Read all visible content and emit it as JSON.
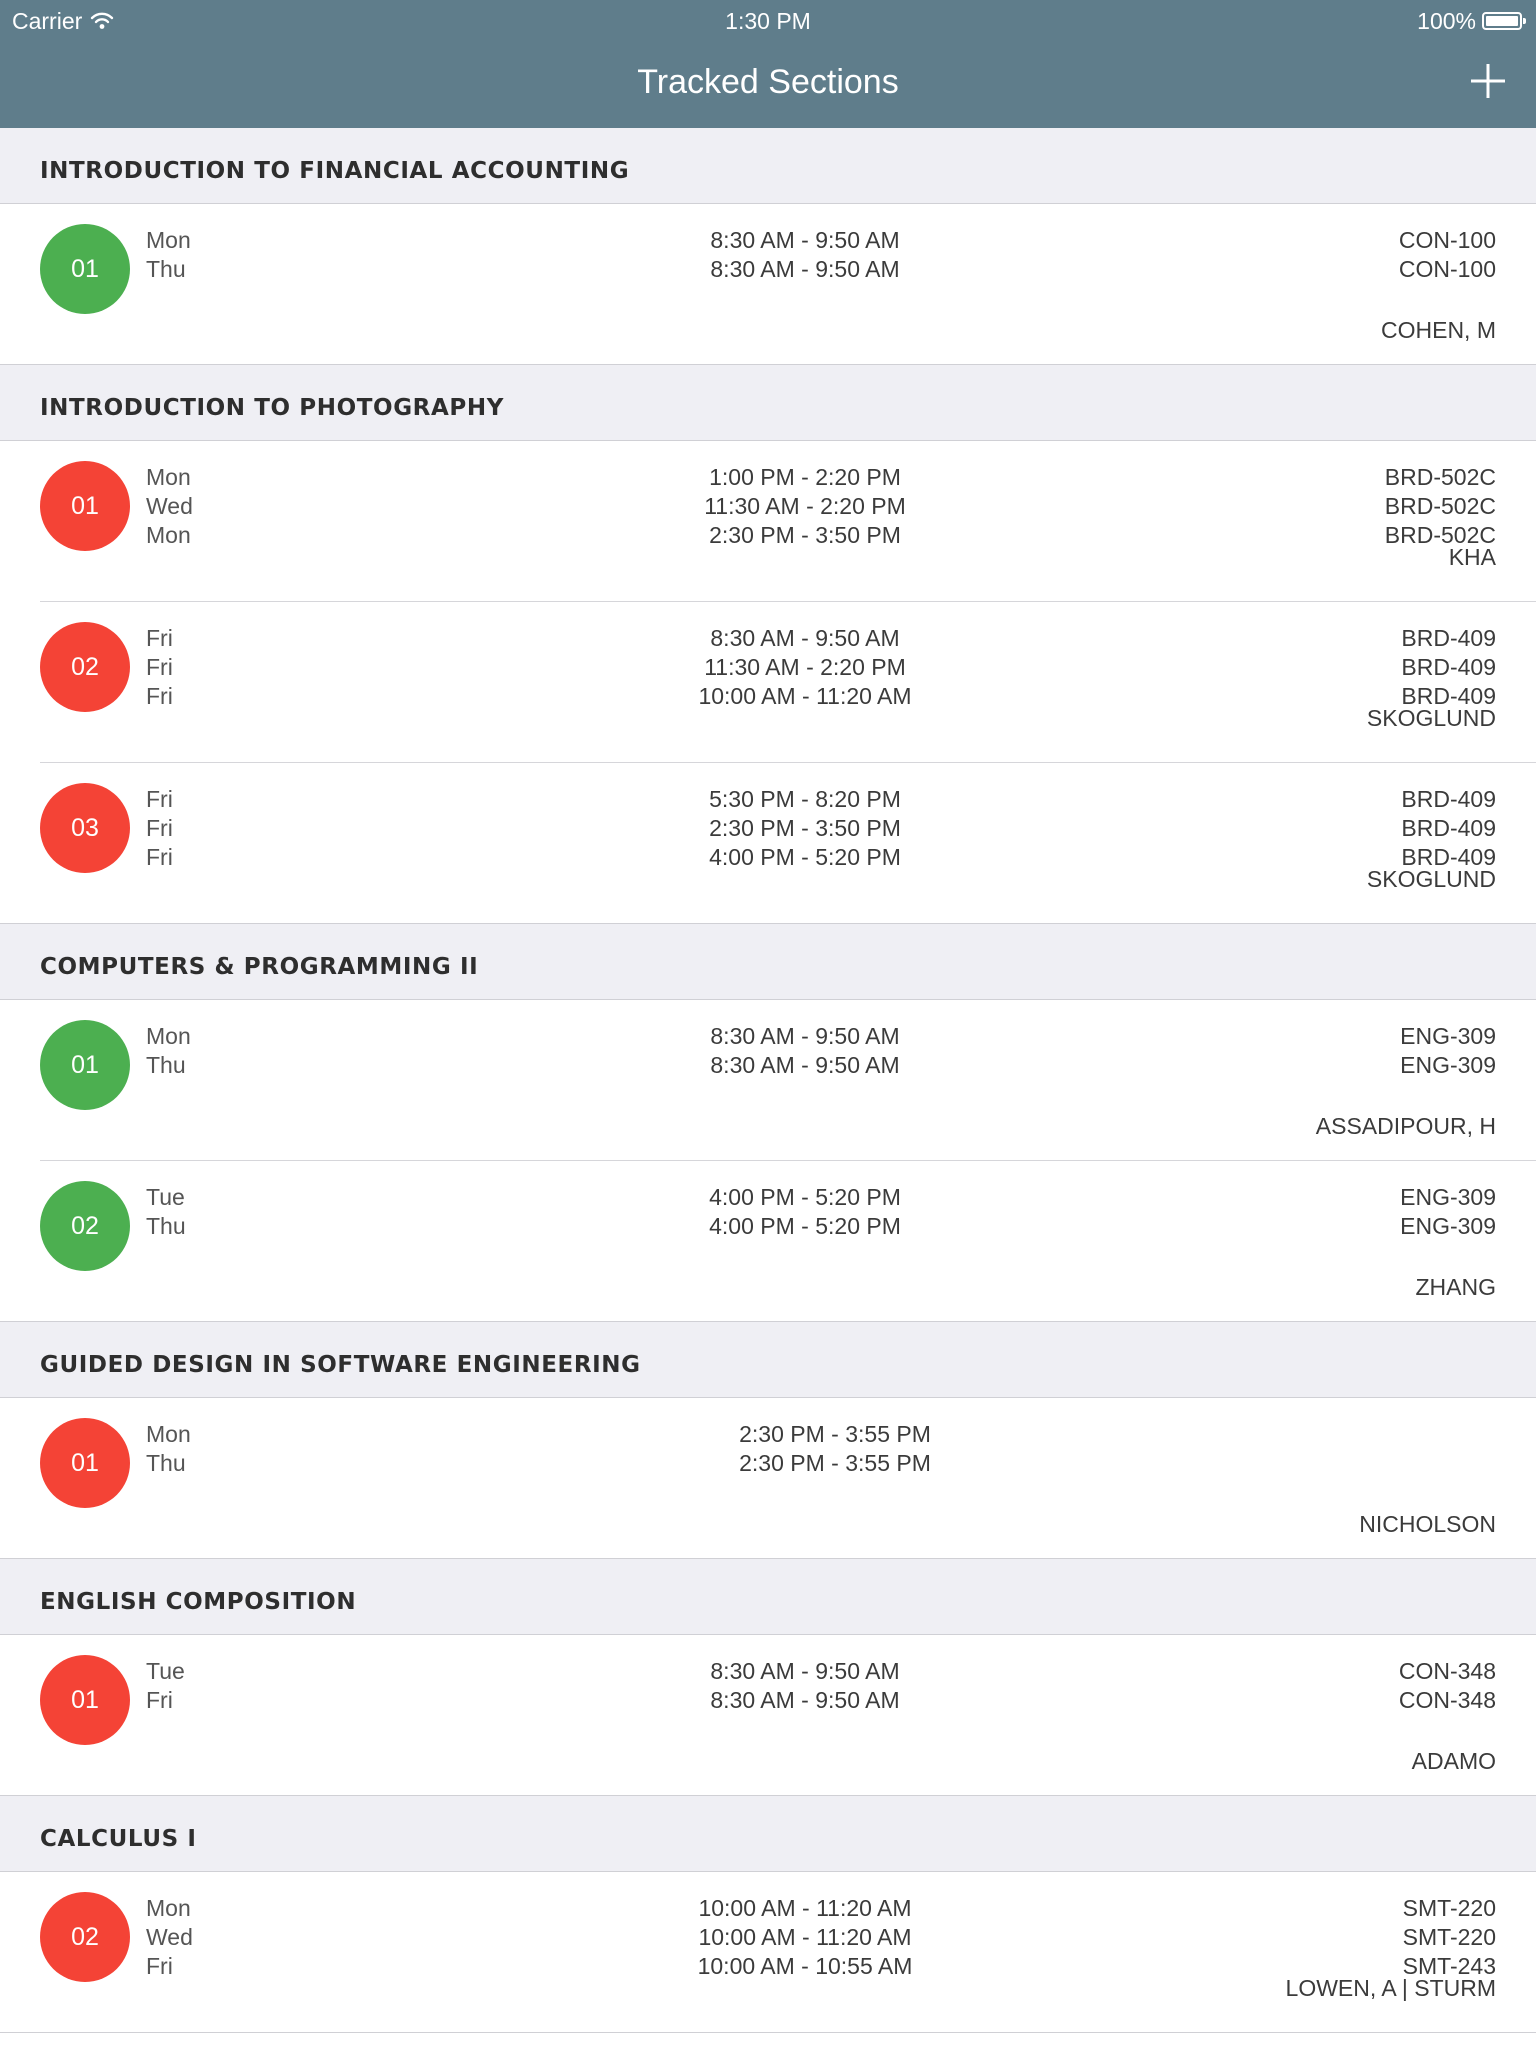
{
  "status_bar": {
    "carrier": "Carrier",
    "time": "1:30 PM",
    "battery": "100%"
  },
  "nav": {
    "title": "Tracked Sections",
    "add_icon": "plus-icon"
  },
  "colors": {
    "open": "#4caf50",
    "closed": "#f44336",
    "nav_bg": "#5f7d8b"
  },
  "courses": [
    {
      "title": "INTRODUCTION TO FINANCIAL ACCOUNTING",
      "sections": [
        {
          "number": "01",
          "status": "open",
          "days": [
            "Mon",
            "Thu"
          ],
          "times": [
            "8:30 AM - 9:50 AM",
            "8:30 AM - 9:50 AM"
          ],
          "rooms": [
            "CON-100",
            "CON-100"
          ],
          "instructor": "COHEN, M"
        }
      ]
    },
    {
      "title": "INTRODUCTION TO PHOTOGRAPHY",
      "sections": [
        {
          "number": "01",
          "status": "closed",
          "days": [
            "Mon",
            "Wed",
            "Mon"
          ],
          "times": [
            "1:00 PM - 2:20 PM",
            "11:30 AM - 2:20 PM",
            "2:30 PM - 3:50 PM"
          ],
          "rooms": [
            "BRD-502C",
            "BRD-502C",
            "BRD-502C"
          ],
          "instructor": "KHA"
        },
        {
          "number": "02",
          "status": "closed",
          "days": [
            "Fri",
            "Fri",
            "Fri"
          ],
          "times": [
            "8:30 AM - 9:50 AM",
            "11:30 AM - 2:20 PM",
            "10:00 AM - 11:20 AM"
          ],
          "rooms": [
            "BRD-409",
            "BRD-409",
            "BRD-409"
          ],
          "instructor": "SKOGLUND"
        },
        {
          "number": "03",
          "status": "closed",
          "days": [
            "Fri",
            "Fri",
            "Fri"
          ],
          "times": [
            "5:30 PM - 8:20 PM",
            "2:30 PM - 3:50 PM",
            "4:00 PM - 5:20 PM"
          ],
          "rooms": [
            "BRD-409",
            "BRD-409",
            "BRD-409"
          ],
          "instructor": "SKOGLUND"
        }
      ]
    },
    {
      "title": "COMPUTERS & PROGRAMMING II",
      "sections": [
        {
          "number": "01",
          "status": "open",
          "days": [
            "Mon",
            "Thu"
          ],
          "times": [
            "8:30 AM - 9:50 AM",
            "8:30 AM - 9:50 AM"
          ],
          "rooms": [
            "ENG-309",
            "ENG-309"
          ],
          "instructor": "ASSADIPOUR, H"
        },
        {
          "number": "02",
          "status": "open",
          "days": [
            "Tue",
            "Thu"
          ],
          "times": [
            "4:00 PM - 5:20 PM",
            "4:00 PM - 5:20 PM"
          ],
          "rooms": [
            "ENG-309",
            "ENG-309"
          ],
          "instructor": "ZHANG"
        }
      ]
    },
    {
      "title": "GUIDED DESIGN IN SOFTWARE ENGINEERING",
      "sections": [
        {
          "number": "01",
          "status": "closed",
          "days": [
            "Mon",
            "Thu"
          ],
          "times": [
            "2:30 PM - 3:55 PM",
            "2:30 PM - 3:55 PM"
          ],
          "rooms": [],
          "instructor": "NICHOLSON"
        }
      ]
    },
    {
      "title": "ENGLISH COMPOSITION",
      "sections": [
        {
          "number": "01",
          "status": "closed",
          "days": [
            "Tue",
            "Fri"
          ],
          "times": [
            "8:30 AM - 9:50 AM",
            "8:30 AM - 9:50 AM"
          ],
          "rooms": [
            "CON-348",
            "CON-348"
          ],
          "instructor": "ADAMO"
        }
      ]
    },
    {
      "title": "CALCULUS I",
      "sections": [
        {
          "number": "02",
          "status": "closed",
          "days": [
            "Mon",
            "Wed",
            "Fri"
          ],
          "times": [
            "10:00 AM - 11:20 AM",
            "10:00 AM - 11:20 AM",
            "10:00 AM - 10:55 AM"
          ],
          "rooms": [
            "SMT-220",
            "SMT-220",
            "SMT-243"
          ],
          "instructor": "LOWEN, A | STURM"
        }
      ]
    }
  ]
}
